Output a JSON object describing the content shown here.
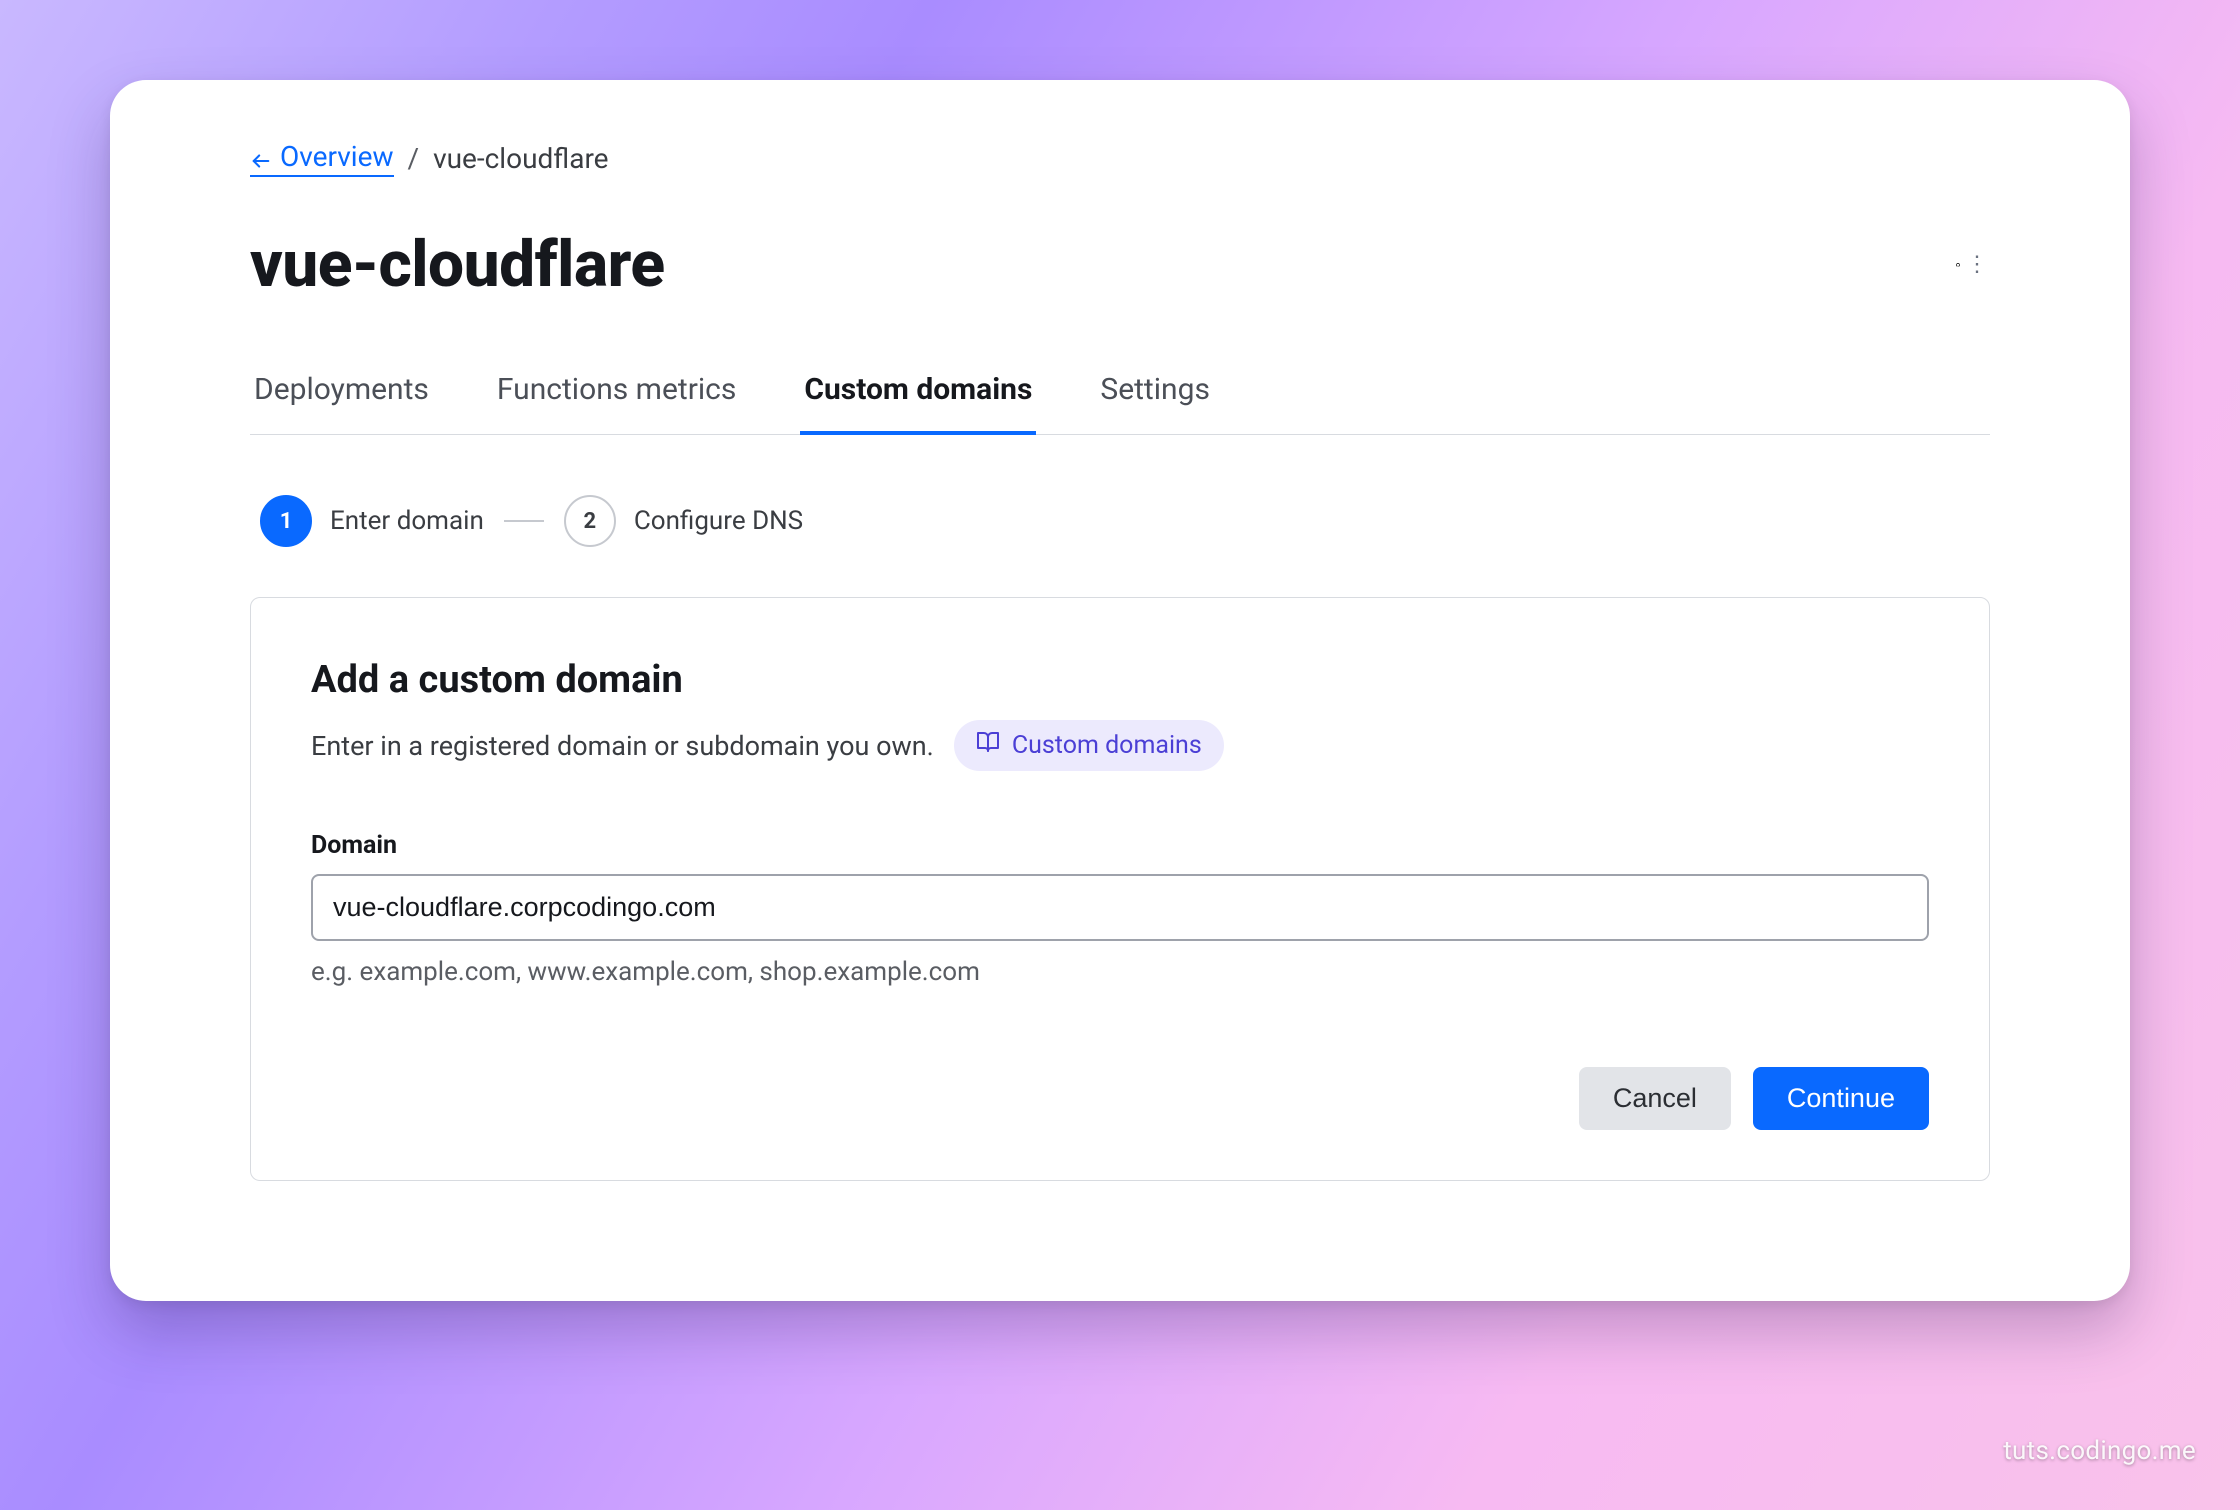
{
  "breadcrumb": {
    "back_label": "Overview",
    "separator": "/",
    "current": "vue-cloudflare"
  },
  "header": {
    "title": "vue-cloudflare",
    "repo_icon": "github-icon"
  },
  "tabs": [
    {
      "label": "Deployments",
      "active": false
    },
    {
      "label": "Functions metrics",
      "active": false
    },
    {
      "label": "Custom domains",
      "active": true
    },
    {
      "label": "Settings",
      "active": false
    }
  ],
  "stepper": [
    {
      "num": "1",
      "label": "Enter domain",
      "active": true
    },
    {
      "num": "2",
      "label": "Configure DNS",
      "active": false
    }
  ],
  "panel": {
    "title": "Add a custom domain",
    "subtitle": "Enter in a registered domain or subdomain you own.",
    "docs_pill": "Custom domains",
    "field_label": "Domain",
    "input_value": "vue-cloudflare.corpcodingo.com",
    "input_placeholder": "",
    "hint": "e.g. example.com, www.example.com, shop.example.com",
    "cancel_label": "Cancel",
    "continue_label": "Continue"
  },
  "footer": {
    "watermark": "tuts.codingo.me"
  }
}
